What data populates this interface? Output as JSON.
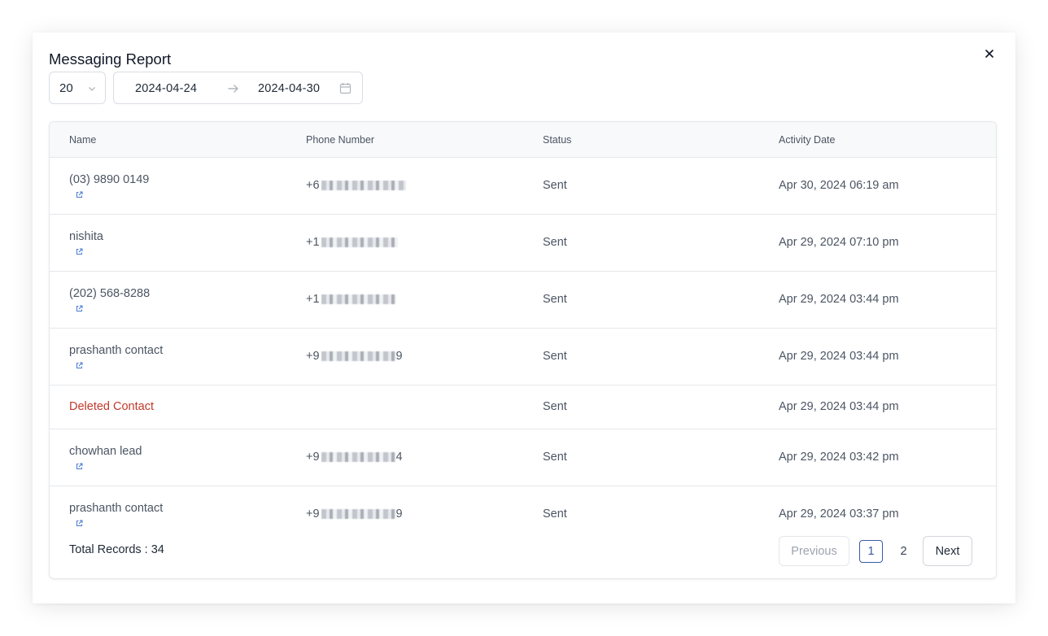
{
  "modal": {
    "title": "Messaging Report"
  },
  "filters": {
    "page_size": "20",
    "date_from": "2024-04-24",
    "date_to": "2024-04-30"
  },
  "table": {
    "columns": [
      "Name",
      "Phone Number",
      "Status",
      "Activity Date"
    ],
    "rows": [
      {
        "name": "(03) 9890 0149",
        "deleted": false,
        "phone_prefix": "+6",
        "phone_suffix": "",
        "status": "Sent",
        "date": "Apr 30, 2024 06:19 am"
      },
      {
        "name": "nishita",
        "deleted": false,
        "phone_prefix": "+1",
        "phone_suffix": "",
        "status": "Sent",
        "date": "Apr 29, 2024 07:10 pm"
      },
      {
        "name": "(202) 568-8288",
        "deleted": false,
        "phone_prefix": "+1",
        "phone_suffix": "",
        "status": "Sent",
        "date": "Apr 29, 2024 03:44 pm"
      },
      {
        "name": "prashanth contact",
        "deleted": false,
        "phone_prefix": "+9",
        "phone_suffix": "9",
        "status": "Sent",
        "date": "Apr 29, 2024 03:44 pm"
      },
      {
        "name": "Deleted Contact",
        "deleted": true,
        "phone_prefix": "",
        "phone_suffix": "",
        "status": "Sent",
        "date": "Apr 29, 2024 03:44 pm"
      },
      {
        "name": "chowhan lead",
        "deleted": false,
        "phone_prefix": "+9",
        "phone_suffix": "4",
        "status": "Sent",
        "date": "Apr 29, 2024 03:42 pm"
      },
      {
        "name": "prashanth contact",
        "deleted": false,
        "phone_prefix": "+9",
        "phone_suffix": "9",
        "status": "Sent",
        "date": "Apr 29, 2024 03:37 pm"
      }
    ]
  },
  "footer": {
    "total_label": "Total Records : 34",
    "previous_label": "Previous",
    "pages": [
      "1",
      "2"
    ],
    "current_page": "1",
    "next_label": "Next"
  },
  "colors": {
    "deleted_contact": "#c0392b",
    "link_icon": "#4a7bd0",
    "active_page": "#3b5ba5"
  }
}
